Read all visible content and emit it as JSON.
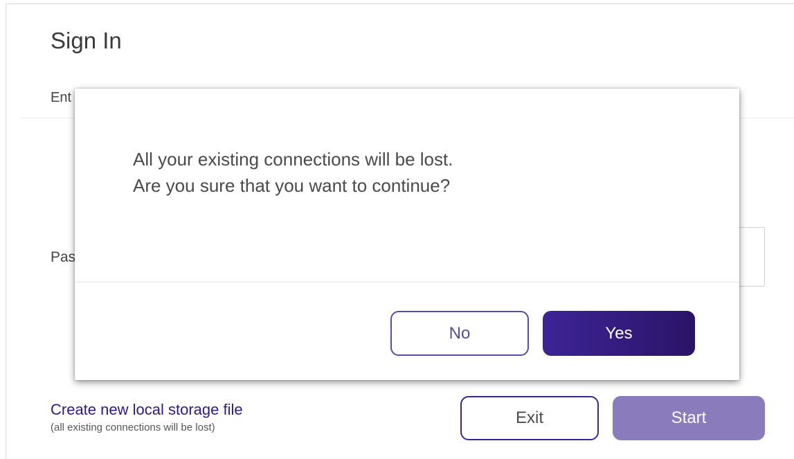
{
  "signin": {
    "title": "Sign In",
    "enter_label_visible": "Ent",
    "password_label_visible": "Pas",
    "create_link": "Create new local storage file",
    "create_note": "(all existing connections will be lost)",
    "exit_label": "Exit",
    "start_label": "Start"
  },
  "dialog": {
    "line1": "All your existing connections will be lost.",
    "line2": "Are you sure that you want to continue?",
    "no_label": "No",
    "yes_label": "Yes"
  },
  "colors": {
    "accent": "#2e1a87",
    "start_disabled": "#8a7bbd",
    "yes_gradient_start": "#3d2496",
    "yes_gradient_end": "#2a1467"
  }
}
